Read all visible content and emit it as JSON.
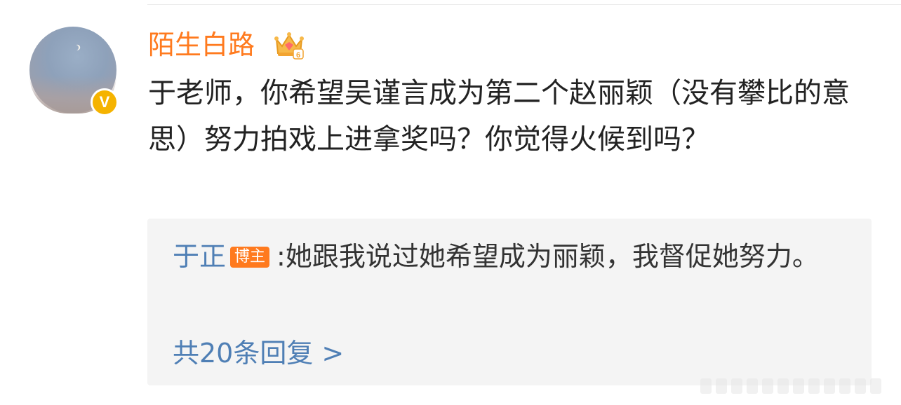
{
  "comment": {
    "username": "陌生白路",
    "crown_level": "6",
    "text": "于老师，你希望吴谨言成为第二个赵丽颖（没有攀比的意思）努力拍戏上进拿奖吗？你觉得火候到吗？",
    "verified_icon_label": "V",
    "avatar": "avatar-night-sky-image",
    "icons": {
      "verified": "verified-v-icon",
      "crown": "crown-level-icon"
    }
  },
  "reply": {
    "author": "于正",
    "author_badge": "博主",
    "separator": ":",
    "text": "她跟我说过她希望成为丽颖，我督促她努力。",
    "more_replies": "共20条回复 >"
  },
  "colors": {
    "username": "#ff7a1e",
    "reply_author": "#4f7fb5",
    "badge": "#ff7a1e",
    "verified": "#f5b300",
    "reply_background": "#f4f4f4"
  }
}
